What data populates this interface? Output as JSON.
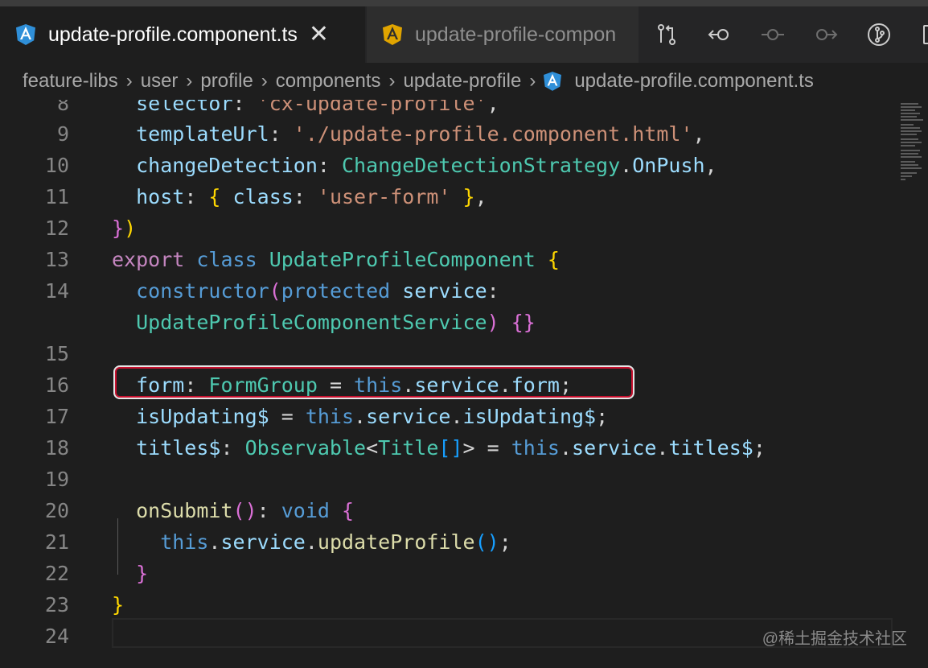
{
  "tabs": [
    {
      "label": "update-profile.component.ts",
      "active": true
    },
    {
      "label": "update-profile-compon",
      "active": false
    }
  ],
  "tab_close_glyph": "✕",
  "toolbar_icons": [
    "compare-changes-icon",
    "go-back-icon",
    "commit-icon",
    "go-forward-icon",
    "git-graph-icon",
    "split-editor-icon"
  ],
  "breadcrumb": {
    "items": [
      "feature-libs",
      "user",
      "profile",
      "components",
      "update-profile"
    ],
    "separator": "›",
    "file": "update-profile.component.ts"
  },
  "line_numbers": [
    "8",
    "9",
    "10",
    "11",
    "12",
    "13",
    "14",
    "",
    "15",
    "16",
    "17",
    "18",
    "19",
    "20",
    "21",
    "22",
    "23",
    "24"
  ],
  "code_lines": [
    "  selector: 'cx-update-profile',",
    "  templateUrl: './update-profile.component.html',",
    "  changeDetection: ChangeDetectionStrategy.OnPush,",
    "  host: { class: 'user-form' },",
    "})",
    "export class UpdateProfileComponent {",
    "  constructor(protected service:",
    "  UpdateProfileComponentService) {}",
    "",
    "  form: FormGroup = this.service.form;",
    "  isUpdating$ = this.service.isUpdating$;",
    "  titles$: Observable<Title[]> = this.service.titles$;",
    "",
    "  onSubmit(): void {",
    "    this.service.updateProfile();",
    "  }",
    "}",
    ""
  ],
  "colors": {
    "keyword": "#c586c0",
    "storage": "#569cd6",
    "type": "#4ec9b0",
    "property": "#9cdcfe",
    "string": "#ce9178",
    "function": "#dcdcaa",
    "angular_red": "#dd0031",
    "highlight_border": "#c8102e"
  },
  "watermark": "@稀土掘金技术社区"
}
